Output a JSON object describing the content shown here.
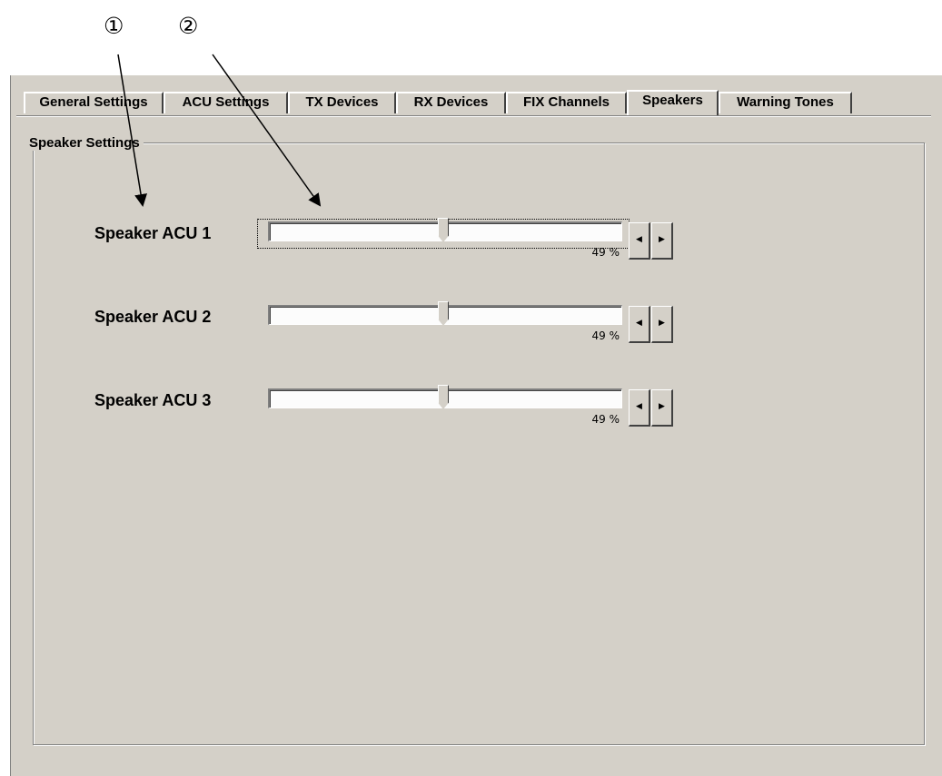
{
  "callouts": [
    "①",
    "②"
  ],
  "tabs": [
    {
      "label": "General Settings",
      "active": false
    },
    {
      "label": "ACU Settings",
      "active": false
    },
    {
      "label": "TX Devices",
      "active": false
    },
    {
      "label": "RX Devices",
      "active": false
    },
    {
      "label": "FIX Channels",
      "active": false
    },
    {
      "label": "Speakers",
      "active": true
    },
    {
      "label": "Warning Tones",
      "active": false
    }
  ],
  "group": {
    "label": "Speaker Settings"
  },
  "speakers": [
    {
      "label": "Speaker ACU 1",
      "value_text": "49 %",
      "value": 49,
      "focused": true
    },
    {
      "label": "Speaker ACU 2",
      "value_text": "49 %",
      "value": 49,
      "focused": false
    },
    {
      "label": "Speaker ACU 3",
      "value_text": "49 %",
      "value": 49,
      "focused": false
    }
  ],
  "icons": {
    "decrease": "arrow-left-icon",
    "increase": "arrow-right-icon"
  }
}
